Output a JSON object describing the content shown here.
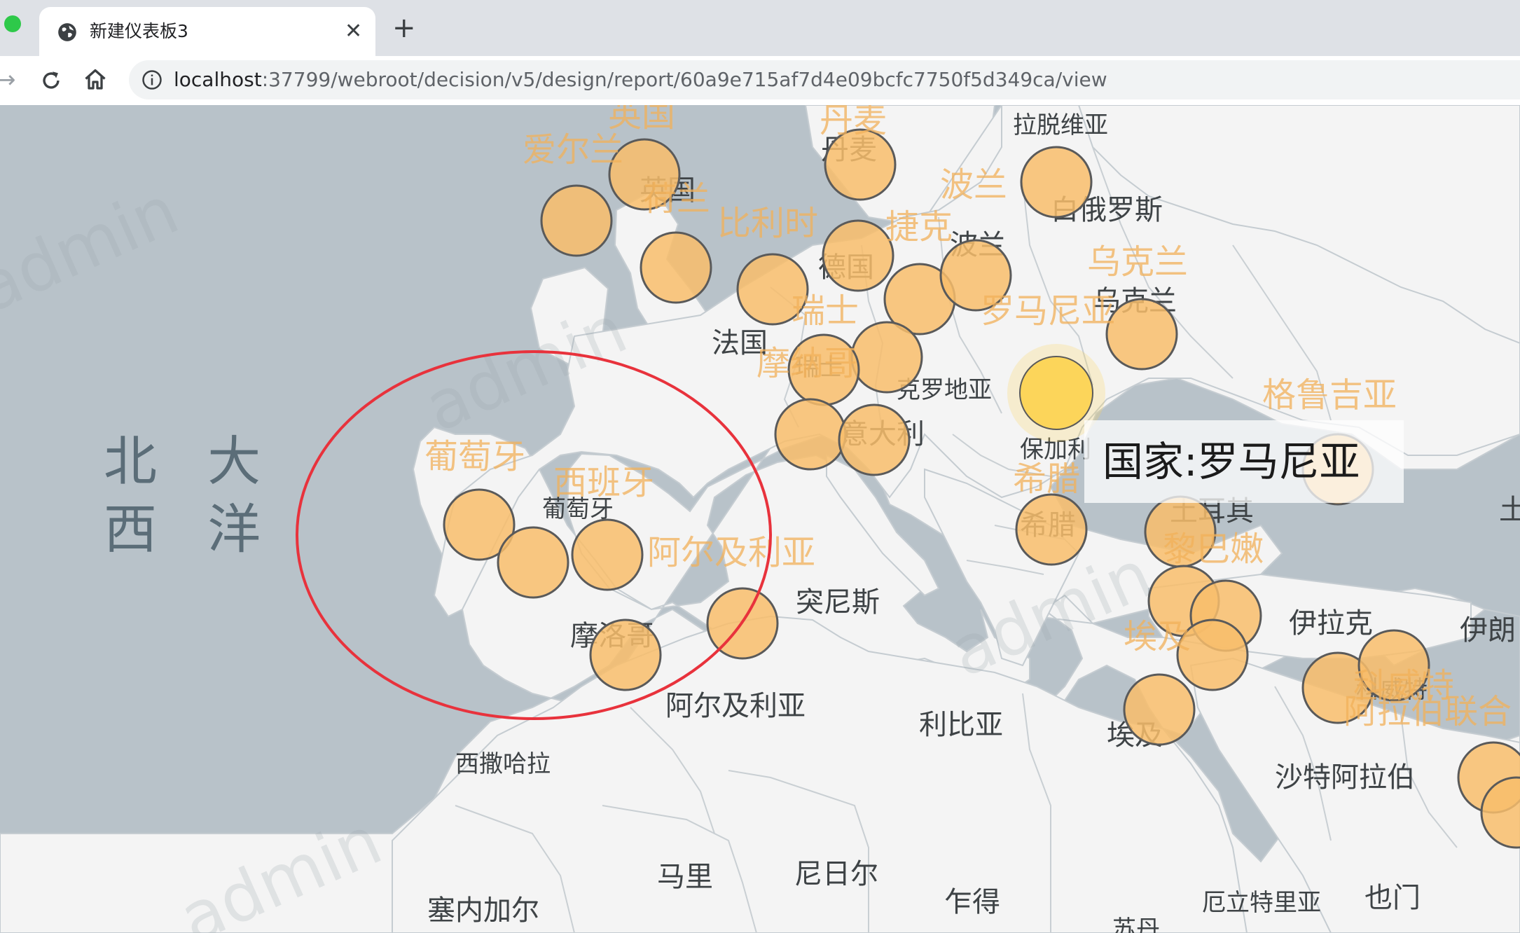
{
  "browser": {
    "tab_title": "新建仪表板3",
    "close_glyph": "✕",
    "new_tab_glyph": "+",
    "url_host": "localhost",
    "url_path": ":37799/webroot/decision/v5/design/report/60a9e715af7d4e09bcfc7750f5d349ca/view"
  },
  "map": {
    "ocean_label_line1": "北 大",
    "ocean_label_line2": "西 洋",
    "watermark_text": "admin",
    "tooltip_text": "国家:罗马尼亚",
    "colors": {
      "sea": "#b8c2c9",
      "land": "#f4f4f4",
      "bubble_fill": "#f8bd6b",
      "bubble_stroke": "#5a5a5a",
      "highlight_fill": "#fcd55a",
      "annotation_ellipse": "#e8323c"
    },
    "base_labels": [
      {
        "name": "country-label",
        "text": "拉脱维亚"
      },
      {
        "name": "country-label",
        "text": "丹麦"
      },
      {
        "name": "country-label",
        "text": "英国"
      },
      {
        "name": "country-label",
        "text": "白俄罗斯"
      },
      {
        "name": "country-label",
        "text": "德国"
      },
      {
        "name": "country-label",
        "text": "波兰"
      },
      {
        "name": "country-label",
        "text": "乌克兰"
      },
      {
        "name": "country-label",
        "text": "法国"
      },
      {
        "name": "country-label",
        "text": "瑞士"
      },
      {
        "name": "country-label",
        "text": "克罗地亚"
      },
      {
        "name": "country-label",
        "text": "意大利"
      },
      {
        "name": "country-label",
        "text": "保加利"
      },
      {
        "name": "country-label",
        "text": "希腊"
      },
      {
        "name": "country-label",
        "text": "土耳其"
      },
      {
        "name": "country-label",
        "text": "葡萄牙"
      },
      {
        "name": "country-label",
        "text": "突尼斯"
      },
      {
        "name": "country-label",
        "text": "摩洛哥"
      },
      {
        "name": "country-label",
        "text": "阿尔及利亚"
      },
      {
        "name": "country-label",
        "text": "利比亚"
      },
      {
        "name": "country-label",
        "text": "埃及"
      },
      {
        "name": "country-label",
        "text": "伊拉克"
      },
      {
        "name": "country-label",
        "text": "伊朗"
      },
      {
        "name": "country-label",
        "text": "科威特"
      },
      {
        "name": "country-label",
        "text": "沙特阿拉伯"
      },
      {
        "name": "country-label",
        "text": "西撒哈拉"
      },
      {
        "name": "country-label",
        "text": "马里"
      },
      {
        "name": "country-label",
        "text": "尼日尔"
      },
      {
        "name": "country-label",
        "text": "乍得"
      },
      {
        "name": "country-label",
        "text": "塞内加尔"
      },
      {
        "name": "country-label",
        "text": "厄立特里亚"
      },
      {
        "name": "country-label",
        "text": "也门"
      },
      {
        "name": "country-label",
        "text": "苏丹"
      },
      {
        "name": "country-label",
        "text": "土"
      }
    ],
    "bubble_labels": [
      {
        "text": "英国"
      },
      {
        "text": "爱尔兰"
      },
      {
        "text": "荷兰"
      },
      {
        "text": "比利时"
      },
      {
        "text": "捷克"
      },
      {
        "text": "波兰"
      },
      {
        "text": "瑞士"
      },
      {
        "text": "摩纳哥"
      },
      {
        "text": "罗马尼亚"
      },
      {
        "text": "乌克兰"
      },
      {
        "text": "格鲁吉亚"
      },
      {
        "text": "希腊"
      },
      {
        "text": "葡萄牙"
      },
      {
        "text": "西班牙"
      },
      {
        "text": "阿尔及利亚"
      },
      {
        "text": "黎巴嫩"
      },
      {
        "text": "埃及"
      },
      {
        "text": "科威特"
      },
      {
        "text": "阿拉伯联合"
      },
      {
        "text": "丹麦"
      }
    ]
  }
}
